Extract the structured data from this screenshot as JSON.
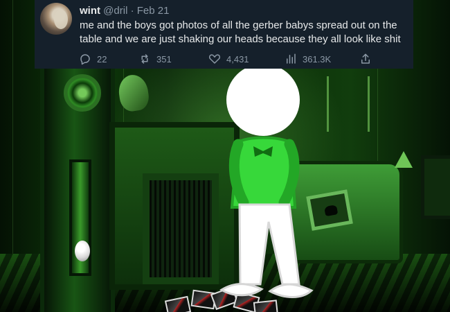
{
  "tweet": {
    "author": {
      "display_name": "wint",
      "handle": "@dril",
      "date": "· Feb 21"
    },
    "text": "me and the boys got photos of all the gerber babys spread out on the table and we are just shaking our heads because they all look like shit",
    "actions": [
      {
        "name": "reply",
        "icon": "reply-icon",
        "count": "22"
      },
      {
        "name": "retweet",
        "icon": "retweet-icon",
        "count": "351"
      },
      {
        "name": "like",
        "icon": "heart-icon",
        "count": "4,431"
      },
      {
        "name": "views",
        "icon": "bar-chart-icon",
        "count": "361.3K"
      },
      {
        "name": "share",
        "icon": "share-icon",
        "count": ""
      }
    ]
  },
  "scene": {
    "theme_color": "#35a92c",
    "figure": {
      "head_color": "#ffffff",
      "shirt_color": "#37d83a",
      "pants_color": "#ffffff"
    }
  }
}
